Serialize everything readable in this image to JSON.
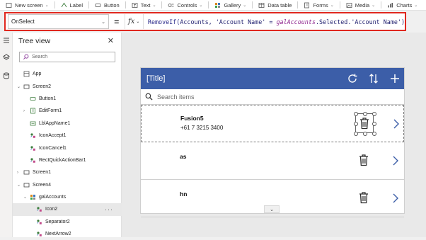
{
  "ribbon": [
    {
      "label": "New screen",
      "icon": "new-screen-icon",
      "has_menu": true
    },
    {
      "label": "Label",
      "icon": "label-icon",
      "has_menu": false
    },
    {
      "label": "Button",
      "icon": "button-icon",
      "has_menu": false
    },
    {
      "label": "Text",
      "icon": "text-icon",
      "has_menu": true
    },
    {
      "label": "Controls",
      "icon": "controls-icon",
      "has_menu": true
    },
    {
      "label": "Gallery",
      "icon": "gallery-icon",
      "has_menu": true
    },
    {
      "label": "Data table",
      "icon": "data-table-icon",
      "has_menu": false
    },
    {
      "label": "Forms",
      "icon": "forms-icon",
      "has_menu": true
    },
    {
      "label": "Media",
      "icon": "media-icon",
      "has_menu": true
    },
    {
      "label": "Charts",
      "icon": "charts-icon",
      "has_menu": true
    }
  ],
  "formula_bar": {
    "property": "OnSelect",
    "equals": "=",
    "fx": "fx",
    "formula_parts": {
      "fn": "RemoveIf(",
      "arg1": "Accounts, ",
      "str1": "'Account Name'",
      "op": " = ",
      "ctl": "galAccounts",
      "rest": ".Selected.",
      "str2": "'Account Name'",
      "close": ")"
    },
    "highlight_color": "#e0281f"
  },
  "tree": {
    "title": "Tree view",
    "search_placeholder": "Search",
    "nodes": [
      {
        "label": "App",
        "icon": "app-icon",
        "level": 0,
        "expander": ""
      },
      {
        "label": "Screen2",
        "icon": "screen-icon",
        "level": 0,
        "expander": "⌄"
      },
      {
        "label": "Button1",
        "icon": "button-icon",
        "level": 1,
        "expander": ""
      },
      {
        "label": "EditForm1",
        "icon": "form-icon",
        "level": 1,
        "expander": "›"
      },
      {
        "label": "LblAppName1",
        "icon": "label-icon",
        "level": 1,
        "expander": ""
      },
      {
        "label": "IconAccept1",
        "icon": "icon-control-icon",
        "level": 1,
        "expander": ""
      },
      {
        "label": "IconCancel1",
        "icon": "icon-control-icon",
        "level": 1,
        "expander": ""
      },
      {
        "label": "RectQuickActionBar1",
        "icon": "rectangle-icon",
        "level": 1,
        "expander": ""
      },
      {
        "label": "Screen1",
        "icon": "screen-icon",
        "level": 0,
        "expander": "›"
      },
      {
        "label": "Screen4",
        "icon": "screen-icon",
        "level": 0,
        "expander": "⌄"
      },
      {
        "label": "galAccounts",
        "icon": "gallery-icon",
        "level": 1,
        "expander": "⌄"
      },
      {
        "label": "Icon2",
        "icon": "icon-control-icon",
        "level": 2,
        "expander": "",
        "selected": true,
        "more": "···"
      },
      {
        "label": "Separator2",
        "icon": "icon-control-icon",
        "level": 2,
        "expander": ""
      },
      {
        "label": "NextArrow2",
        "icon": "icon-control-icon",
        "level": 2,
        "expander": ""
      }
    ]
  },
  "app": {
    "title": "[Title]",
    "header_color": "#3c5ea8",
    "search_placeholder": "Search items",
    "items": [
      {
        "title": "Fusion5",
        "subtitle": "+61 7 3215 3400"
      },
      {
        "title": "as",
        "subtitle": ""
      },
      {
        "title": "hn",
        "subtitle": ""
      }
    ],
    "scroll_indicator": "⌄"
  }
}
